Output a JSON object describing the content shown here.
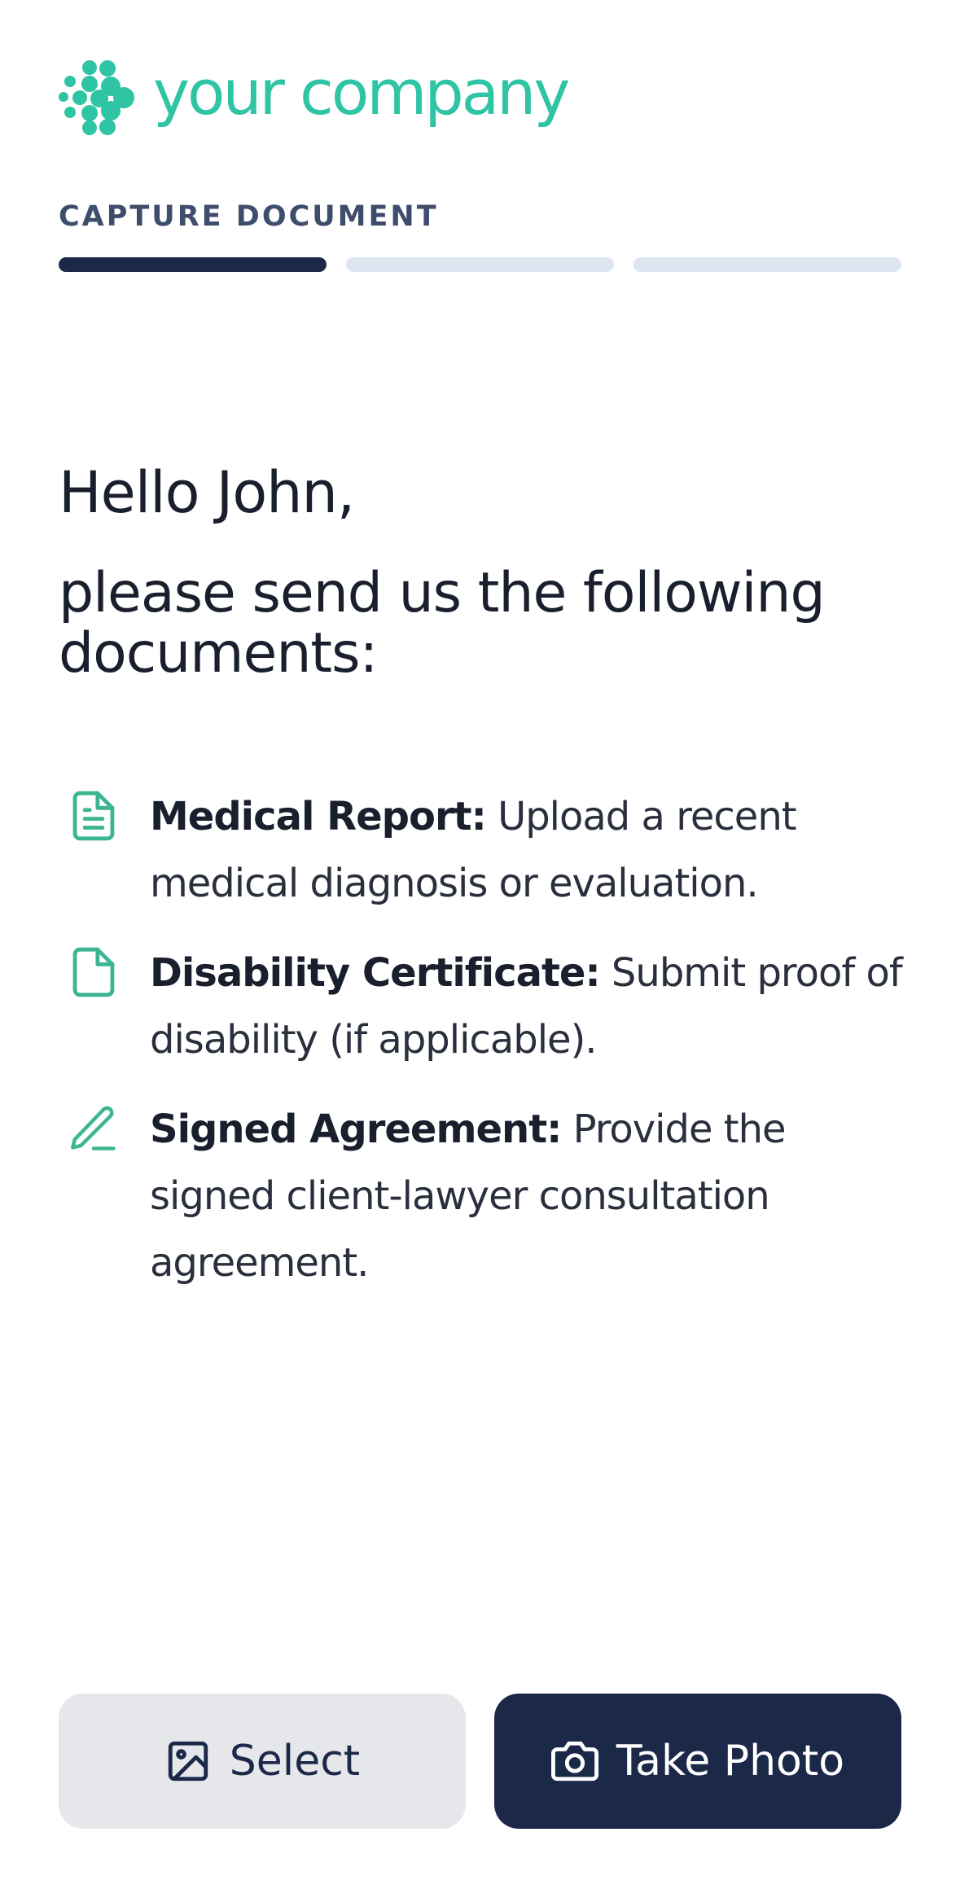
{
  "brand": {
    "name": "your company",
    "logo_icon": "dots-logo-icon",
    "color": "#2fc4a4"
  },
  "step": {
    "label": "CAPTURE DOCUMENT",
    "current": 1,
    "total": 3
  },
  "greeting": "Hello John,",
  "subtitle": "please send us the following documents:",
  "documents": [
    {
      "icon": "file-text-icon",
      "title": "Medical Report:",
      "description": "Upload a recent medical diagnosis or evaluation."
    },
    {
      "icon": "file-icon",
      "title": "Disability Certificate:",
      "description": "Submit proof of disability (if applicable)."
    },
    {
      "icon": "pen-icon",
      "title": "Signed Agreement:",
      "description": "Provide the signed client-lawyer consultation agreement."
    }
  ],
  "actions": {
    "select_label": "Select",
    "select_icon": "image-icon",
    "photo_label": "Take Photo",
    "photo_icon": "camera-icon"
  },
  "colors": {
    "accent": "#2fc4a4",
    "primary": "#1c2848",
    "progress_inactive": "#dde5f0",
    "secondary_button": "#e5e7eb"
  }
}
